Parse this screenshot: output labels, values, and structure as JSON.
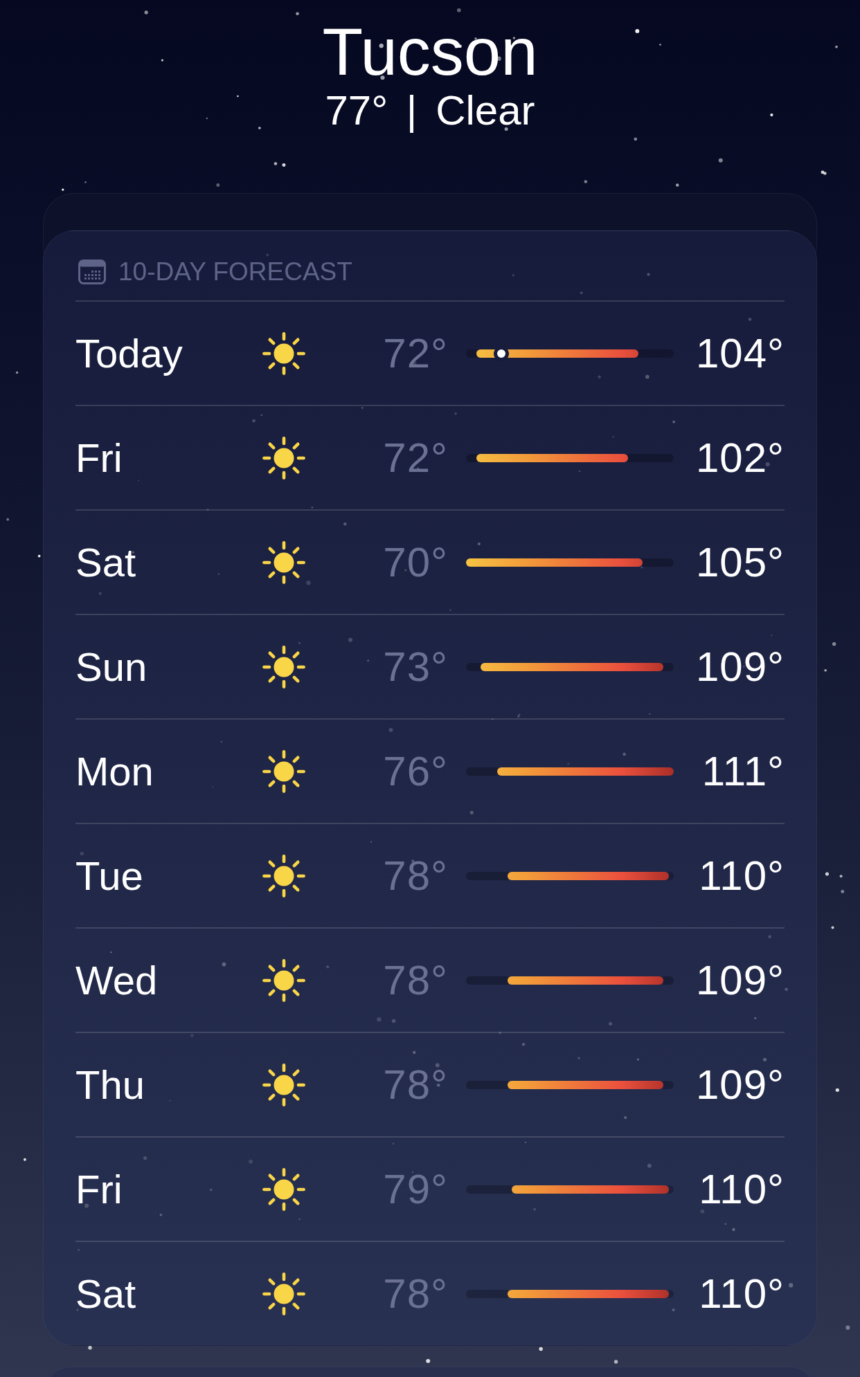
{
  "header": {
    "city": "Tucson",
    "summary": "77° | Clear"
  },
  "daily_card": {
    "title": "10-DAY FORECAST",
    "days": [
      {
        "day": "Today",
        "low": "72°",
        "high": "104°",
        "bar": {
          "left_gap": {
            "level": 0.05
          },
          "right_gap": {
            "level": 0.17
          }
        },
        "current": {
          "level": 0.17
        }
      },
      {
        "day": "Fri",
        "low": "72°",
        "high": "102°",
        "bar": {
          "left_gap": {
            "level": 0.05
          },
          "right_gap": {
            "level": 0.22
          }
        }
      },
      {
        "day": "Sat",
        "low": "70°",
        "high": "105°",
        "bar": {
          "right_gap": {
            "level": 0.15
          }
        }
      },
      {
        "day": "Sun",
        "low": "73°",
        "high": "109°",
        "bar": {
          "left_gap": {
            "level": 0.07
          },
          "right_gap": {
            "level": 0.05
          }
        }
      },
      {
        "day": "Mon",
        "low": "76°",
        "high": "111°",
        "bar": {
          "left_gap": {
            "level": 0.15
          }
        }
      },
      {
        "day": "Tue",
        "low": "78°",
        "high": "110°",
        "bar": {
          "left_gap": {
            "level": 0.2
          },
          "right_gap": {
            "level": 0.025
          }
        }
      },
      {
        "day": "Wed",
        "low": "78°",
        "high": "109°",
        "bar": {
          "left_gap": {
            "level": 0.2
          },
          "right_gap": {
            "level": 0.05
          }
        }
      },
      {
        "day": "Thu",
        "low": "78°",
        "high": "109°",
        "bar": {
          "left_gap": {
            "level": 0.2
          },
          "right_gap": {
            "level": 0.05
          }
        }
      },
      {
        "day": "Fri",
        "low": "79°",
        "high": "110°",
        "bar": {
          "left_gap": {
            "level": 0.22
          },
          "right_gap": {
            "level": 0.025
          }
        }
      },
      {
        "day": "Sat",
        "low": "78°",
        "high": "110°",
        "bar": {
          "left_gap": {
            "level": 0.2
          },
          "right_gap": {
            "level": 0.025
          }
        }
      }
    ]
  }
}
